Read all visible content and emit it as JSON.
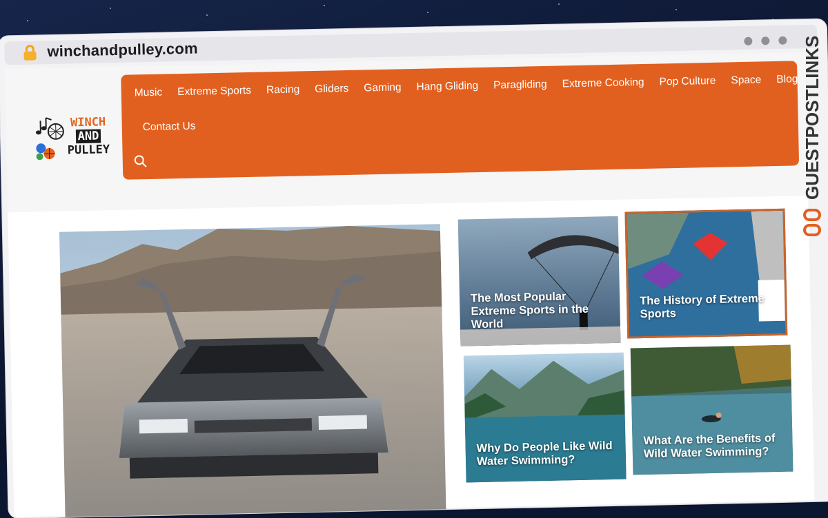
{
  "browser": {
    "url": "winchandpulley.com"
  },
  "logo": {
    "line1": "WINCH",
    "line2": "AND",
    "line3": "PULLEY"
  },
  "nav": {
    "items": [
      "Music",
      "Extreme Sports",
      "Racing",
      "Gliders",
      "Gaming",
      "Hang Gliding",
      "Paragliding",
      "Extreme Cooking",
      "Pop Culture",
      "Space",
      "Blog"
    ],
    "contact": "Contact Us"
  },
  "articles": [
    {
      "title": "The Most Popular Extreme Sports in the World"
    },
    {
      "title": "The History of Extreme Sports"
    },
    {
      "title": "Why Do People Like Wild Water Swimming?"
    },
    {
      "title": "What Are the Benefits of Wild Water Swimming?"
    }
  ],
  "watermark": "GUESTPOSTLINKS",
  "colors": {
    "accent": "#e2601f",
    "background": "#0b1630"
  }
}
